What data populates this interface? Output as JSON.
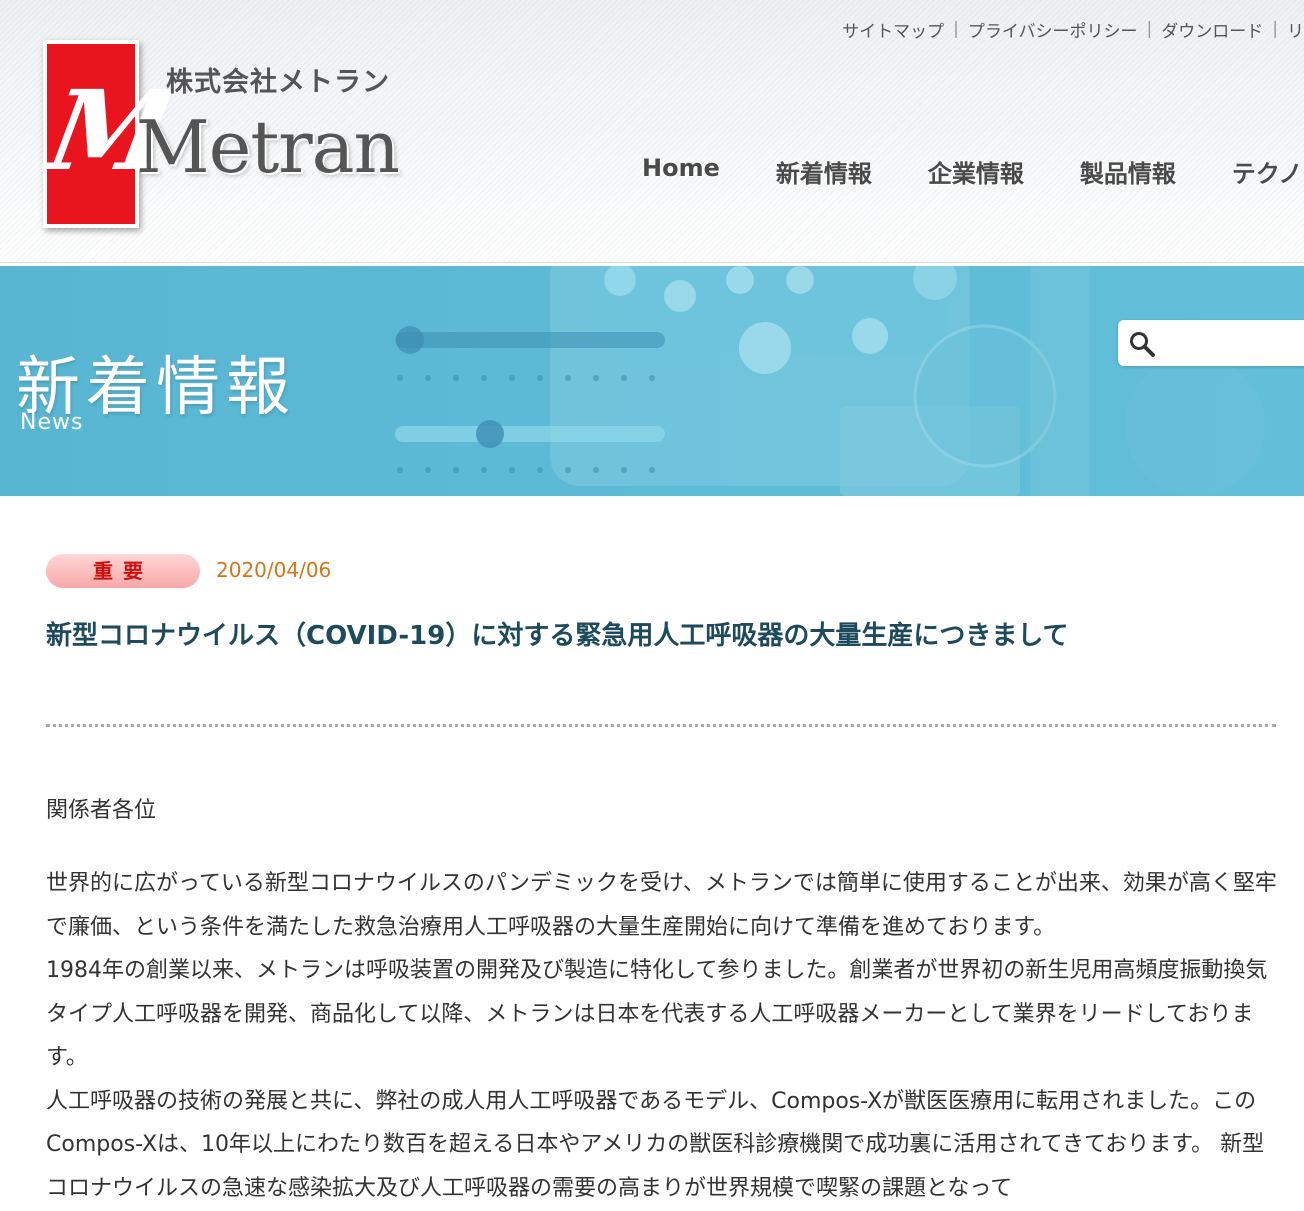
{
  "header": {
    "util_links": [
      {
        "label": "サイトマップ"
      },
      {
        "label": "プライバシーポリシー"
      },
      {
        "label": "ダウンロード"
      },
      {
        "label": "リ"
      }
    ],
    "logo": {
      "kana": "株式会社メトラン",
      "mark": "M",
      "wordmark": "Metran",
      "mark_color": "#e8141e"
    },
    "nav": [
      {
        "label": "Home"
      },
      {
        "label": "新着情報"
      },
      {
        "label": "企業情報"
      },
      {
        "label": "製品情報"
      },
      {
        "label": "テクノ"
      }
    ]
  },
  "banner": {
    "title": "新着情報",
    "subtitle": "News",
    "search_placeholder": "",
    "background_color": "#5cbad6"
  },
  "article": {
    "badge": "重要",
    "date": "2020/04/06",
    "title": "新型コロナウイルス（COVID-19）に対する緊急用人工呼吸器の大量生産につきまして",
    "salutation": "関係者各位",
    "paragraphs": [
      "世界的に広がっている新型コロナウイルスのパンデミックを受け、メトランでは簡単に使用することが出来、効果が高く堅牢で廉価、という条件を満たした救急治療用人工呼吸器の大量生産開始に向けて準備を進めております。",
      "1984年の創業以来、メトランは呼吸装置の開発及び製造に特化して参りました。創業者が世界初の新生児用高頻度振動換気タイプ人工呼吸器を開発、商品化して以降、メトランは日本を代表する人工呼吸器メーカーとして業界をリードしております。",
      "人工呼吸器の技術の発展と共に、弊社の成人用人工呼吸器であるモデル、Compos-Xが獣医医療用に転用されました。このCompos-Xは、10年以上にわたり数百を超える日本やアメリカの獣医科診療機関で成功裏に活用されてきております。 新型コロナウイルスの急速な感染拡大及び人工呼吸器の需要の高まりが世界規模で喫緊の課題となって"
    ],
    "badge_color": "#cc1111",
    "date_color": "#d4751a",
    "title_color": "#1d4a5c"
  }
}
